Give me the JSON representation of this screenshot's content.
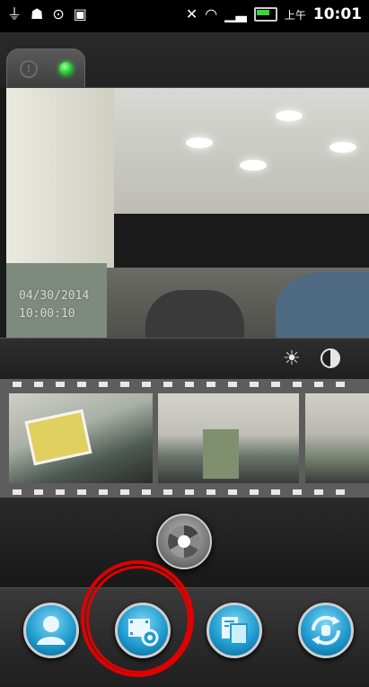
{
  "status_bar": {
    "icons": [
      "usb-icon",
      "android-debug-icon",
      "sync-icon",
      "media-icon",
      "mute-icon",
      "wifi-icon",
      "signal-icon",
      "battery-icon"
    ],
    "ampm": "上午",
    "time": "10:01"
  },
  "camera_tab": {
    "status_off": "!",
    "status_on_color": "#1fbf2a"
  },
  "main_video": {
    "timestamp_date": "04/30/2014",
    "timestamp_time": "10:00:10"
  },
  "controls": {
    "brightness_icon": "brightness-icon",
    "contrast_icon": "contrast-icon"
  },
  "filmstrip": {
    "thumbnails": [
      "thumbnail-1",
      "thumbnail-2",
      "thumbnail-3"
    ]
  },
  "bottom_nav": {
    "buttons": [
      "profile-button",
      "video-settings-button",
      "gallery-button",
      "switch-camera-button"
    ],
    "highlighted": "video-settings-button",
    "highlight_color": "#e00000"
  }
}
